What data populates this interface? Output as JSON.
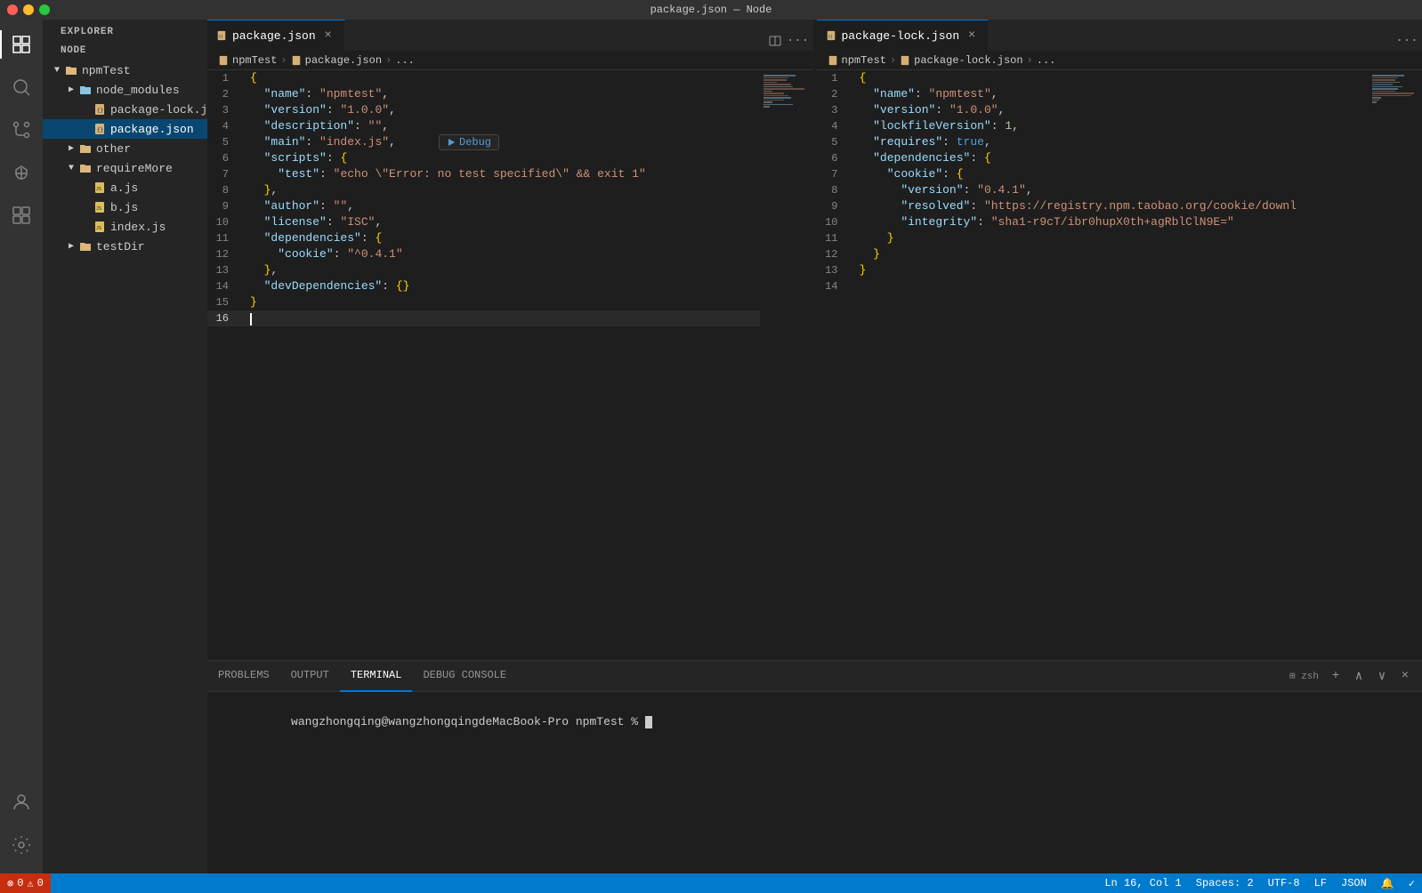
{
  "titleBar": {
    "title": "package.json — Node"
  },
  "activityBar": {
    "icons": [
      "explorer",
      "search",
      "source-control",
      "debug",
      "extensions",
      "account",
      "settings"
    ]
  },
  "sidebar": {
    "header": "Explorer",
    "tree": {
      "root": "NODE",
      "items": [
        {
          "id": "npmTest",
          "label": "npmTest",
          "type": "folder-open",
          "level": 0,
          "open": true
        },
        {
          "id": "node_modules",
          "label": "node_modules",
          "type": "folder",
          "level": 1,
          "open": false
        },
        {
          "id": "package-lock",
          "label": "package-lock.js...",
          "type": "json",
          "level": 1
        },
        {
          "id": "package-json",
          "label": "package.json",
          "type": "json",
          "level": 1,
          "selected": true
        },
        {
          "id": "other",
          "label": "other",
          "type": "folder",
          "level": 1,
          "open": false
        },
        {
          "id": "requireMore",
          "label": "requireMore",
          "type": "folder-open",
          "level": 1,
          "open": true
        },
        {
          "id": "a-js",
          "label": "a.js",
          "type": "js",
          "level": 2
        },
        {
          "id": "b-js",
          "label": "b.js",
          "type": "js",
          "level": 2
        },
        {
          "id": "index-js",
          "label": "index.js",
          "type": "js",
          "level": 2
        },
        {
          "id": "testDir",
          "label": "testDir",
          "type": "folder",
          "level": 1,
          "open": false
        }
      ]
    }
  },
  "leftEditor": {
    "tab": {
      "filename": "package.json",
      "icon": "json",
      "modified": false
    },
    "breadcrumb": [
      "npmTest",
      "package.json",
      "..."
    ],
    "lines": [
      {
        "n": 1,
        "content": "{"
      },
      {
        "n": 2,
        "content": "  \"name\": \"npmtest\","
      },
      {
        "n": 3,
        "content": "  \"version\": \"1.0.0\","
      },
      {
        "n": 4,
        "content": "  \"description\": \"\","
      },
      {
        "n": 5,
        "content": "  \"main\": \"index.js\","
      },
      {
        "n": 6,
        "content": "  \"scripts\": {"
      },
      {
        "n": 7,
        "content": "    \"test\": \"echo \\\"Error: no test specified\\\" && exit 1\""
      },
      {
        "n": 8,
        "content": "  },"
      },
      {
        "n": 9,
        "content": "  \"author\": \"\","
      },
      {
        "n": 10,
        "content": "  \"license\": \"ISC\","
      },
      {
        "n": 11,
        "content": "  \"dependencies\": {"
      },
      {
        "n": 12,
        "content": "    \"cookie\": \"^0.4.1\""
      },
      {
        "n": 13,
        "content": "  },"
      },
      {
        "n": 14,
        "content": "  \"devDependencies\": {}"
      },
      {
        "n": 15,
        "content": "}"
      },
      {
        "n": 16,
        "content": ""
      }
    ],
    "debugWidget": "Debug",
    "debugLine": 5
  },
  "rightEditor": {
    "tab": {
      "filename": "package-lock.json",
      "icon": "json",
      "modified": false
    },
    "breadcrumb": [
      "npmTest",
      "package-lock.json",
      "..."
    ],
    "lines": [
      {
        "n": 1,
        "content": "{"
      },
      {
        "n": 2,
        "content": "  \"name\": \"npmtest\","
      },
      {
        "n": 3,
        "content": "  \"version\": \"1.0.0\","
      },
      {
        "n": 4,
        "content": "  \"lockfileVersion\": 1,"
      },
      {
        "n": 5,
        "content": "  \"requires\": true,"
      },
      {
        "n": 6,
        "content": "  \"dependencies\": {"
      },
      {
        "n": 7,
        "content": "    \"cookie\": {"
      },
      {
        "n": 8,
        "content": "      \"version\": \"0.4.1\","
      },
      {
        "n": 9,
        "content": "      \"resolved\": \"https://registry.npm.taobao.org/cookie/downl"
      },
      {
        "n": 10,
        "content": "      \"integrity\": \"sha1-r9cT/ibr0hupX0th+agRblClN9E=\""
      },
      {
        "n": 11,
        "content": "    }"
      },
      {
        "n": 12,
        "content": "  }"
      },
      {
        "n": 13,
        "content": "}"
      },
      {
        "n": 14,
        "content": ""
      }
    ]
  },
  "panel": {
    "tabs": [
      "PROBLEMS",
      "OUTPUT",
      "TERMINAL",
      "DEBUG CONSOLE"
    ],
    "activeTab": "TERMINAL",
    "terminal": {
      "prompt": "wangzhongqing@wangzhongqingdeMacBook-Pro npmTest % "
    }
  },
  "statusBar": {
    "left": [
      {
        "id": "branch",
        "icon": "⊗",
        "text": "0"
      },
      {
        "id": "errors",
        "icon": "⚠",
        "text": "0 △ 0"
      }
    ],
    "right": [
      {
        "id": "position",
        "text": "Ln 16, Col 1"
      },
      {
        "id": "spaces",
        "text": "Spaces: 2"
      },
      {
        "id": "encoding",
        "text": "UTF-8"
      },
      {
        "id": "eol",
        "text": "LF"
      },
      {
        "id": "language",
        "text": "JSON"
      },
      {
        "id": "feedback",
        "icon": "🔔"
      },
      {
        "id": "extra",
        "icon": "✓"
      }
    ]
  }
}
